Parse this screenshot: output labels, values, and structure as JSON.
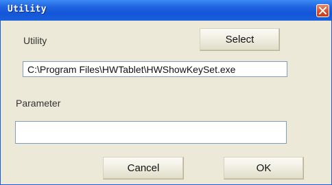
{
  "window": {
    "title": "Utility",
    "close_icon": "close-x-icon"
  },
  "utility": {
    "label": "Utility",
    "select_label": "Select",
    "path_value": "C:\\Program Files\\HWTablet\\HWShowKeySet.exe"
  },
  "parameter": {
    "label": "Parameter",
    "value": ""
  },
  "footer": {
    "cancel_label": "Cancel",
    "ok_label": "OK"
  },
  "colors": {
    "titlebar": "#1356d8",
    "window_bg": "#ece9d8",
    "close_button": "#d8512b"
  }
}
